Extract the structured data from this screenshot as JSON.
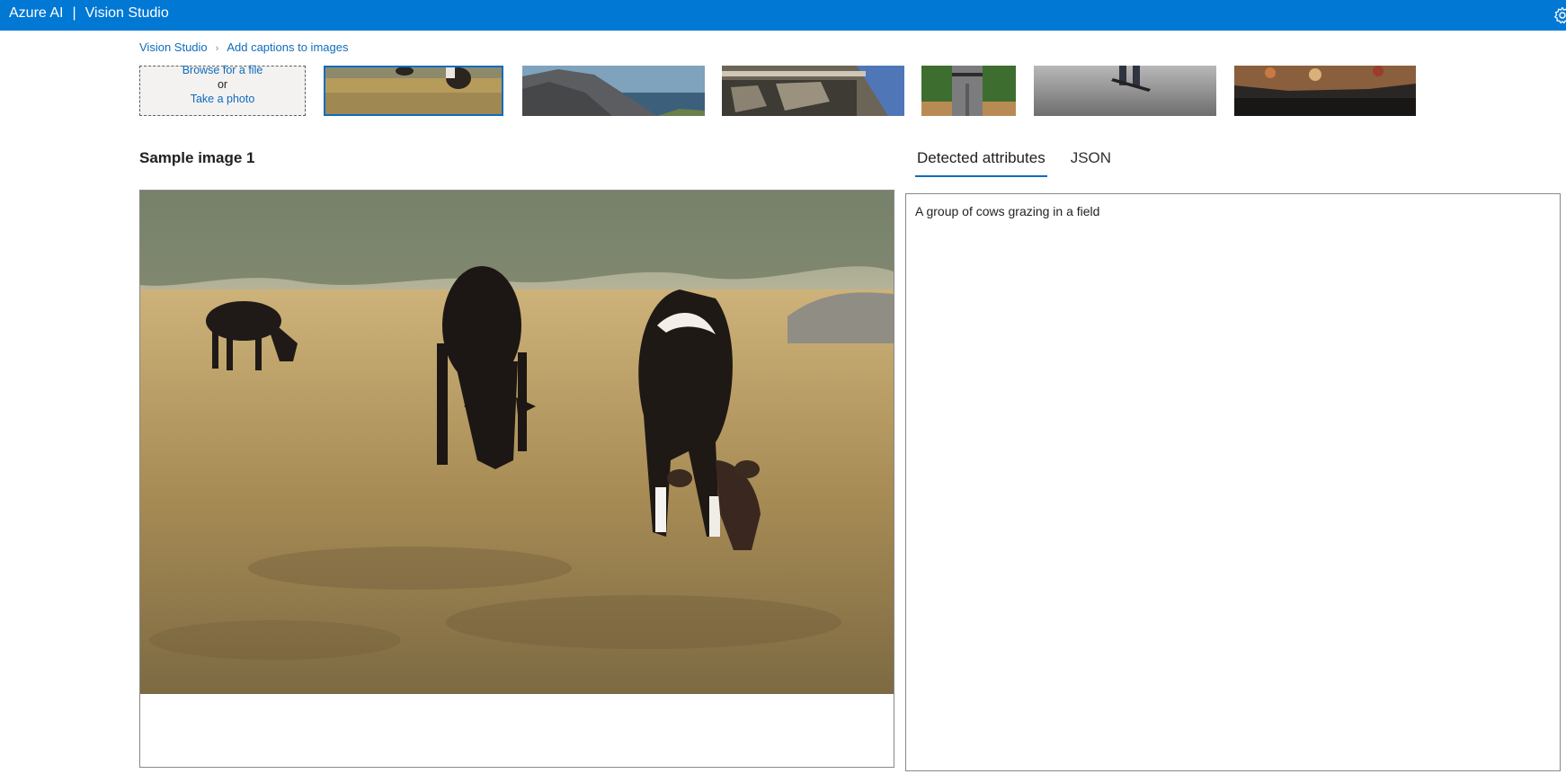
{
  "app": {
    "brand": "Azure AI",
    "separator": "|",
    "product": "Vision Studio"
  },
  "icons": {
    "settings": "gear-icon",
    "breadcrumb_separator": "chevron-right-icon"
  },
  "breadcrumb": {
    "items": [
      "Vision Studio",
      "Add captions to images"
    ]
  },
  "upload": {
    "browse": "Browse for a file",
    "or": "or",
    "take_photo": "Take a photo"
  },
  "thumbnails": [
    {
      "subject": "cows grazing in a field",
      "selected": true
    },
    {
      "subject": "rocky coastline",
      "selected": false
    },
    {
      "subject": "carved building facade",
      "selected": false
    },
    {
      "subject": "baseball player",
      "selected": false
    },
    {
      "subject": "skateboarder",
      "selected": false
    },
    {
      "subject": "food on a table",
      "selected": false
    }
  ],
  "main": {
    "sample_title": "Sample image 1",
    "tabs": [
      {
        "label": "Detected attributes",
        "active": true
      },
      {
        "label": "JSON",
        "active": false
      }
    ],
    "caption": "A group of cows grazing in a field"
  },
  "colors": {
    "header": "#0078d4",
    "link": "#0f6cbd",
    "text": "#201f1e",
    "border": "#8a8886"
  }
}
